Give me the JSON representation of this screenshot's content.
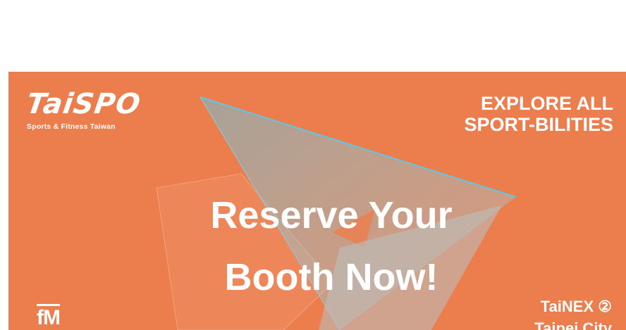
{
  "logo": {
    "wordmark": "TaiSPO",
    "subtitle": "Sports & Fitness Taiwan"
  },
  "tagline": {
    "line1": "EXPLORE ALL",
    "line2": "SPORT-BILITIES"
  },
  "cta": {
    "line1": "Reserve Your",
    "line2": "Booth Now!"
  },
  "venue": {
    "line1": "TaiNEX ②",
    "line2": "Taipei City"
  },
  "partner_logo": "fM",
  "colors": {
    "background": "#ec7d4d",
    "text": "#ffffff",
    "accent_cyan": "#5ec8e6"
  }
}
